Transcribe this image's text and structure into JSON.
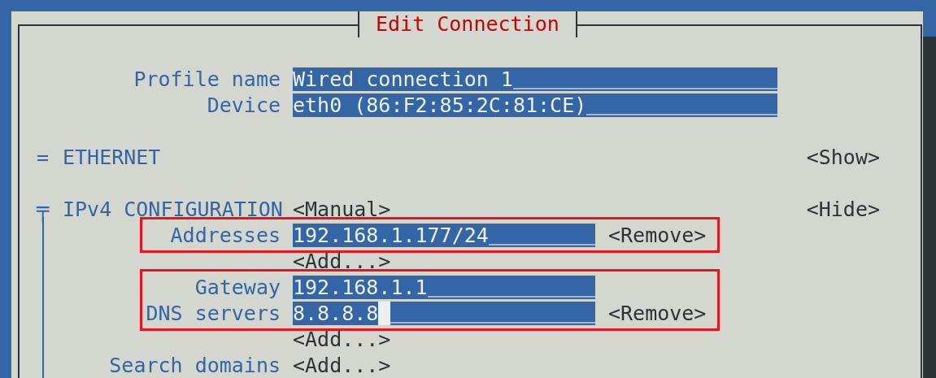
{
  "dialog": {
    "title": "Edit Connection"
  },
  "fields": [
    {
      "label": "Profile name",
      "value": "Wired connection 1"
    },
    {
      "label": "Device",
      "value": "eth0 (86:F2:85:2C:81:CE)"
    }
  ],
  "sections": [
    {
      "marker": "=",
      "title": "ETHERNET",
      "toggle": "<Show>",
      "expanded": false
    },
    {
      "marker": "╤",
      "title": "IPv4 CONFIGURATION",
      "mode": "<Manual>",
      "toggle": "<Hide>",
      "expanded": true,
      "items": [
        {
          "kind": "highlight",
          "rows": [
            {
              "kind": "entry",
              "label": "Addresses",
              "value": "192.168.1.177/24",
              "action": "<Remove>",
              "cursor": false
            }
          ]
        },
        {
          "kind": "button",
          "button": "<Add...>"
        },
        {
          "kind": "highlight",
          "rows": [
            {
              "kind": "entry",
              "label": "Gateway",
              "value": "192.168.1.1",
              "cursor": false
            },
            {
              "kind": "entry",
              "label": "DNS servers",
              "value": "8.8.8.8",
              "action": "<Remove>",
              "cursor": true
            }
          ]
        },
        {
          "kind": "button",
          "button": "<Add...>"
        },
        {
          "kind": "button",
          "label": "Search domains",
          "button": "<Add...>"
        }
      ]
    }
  ]
}
